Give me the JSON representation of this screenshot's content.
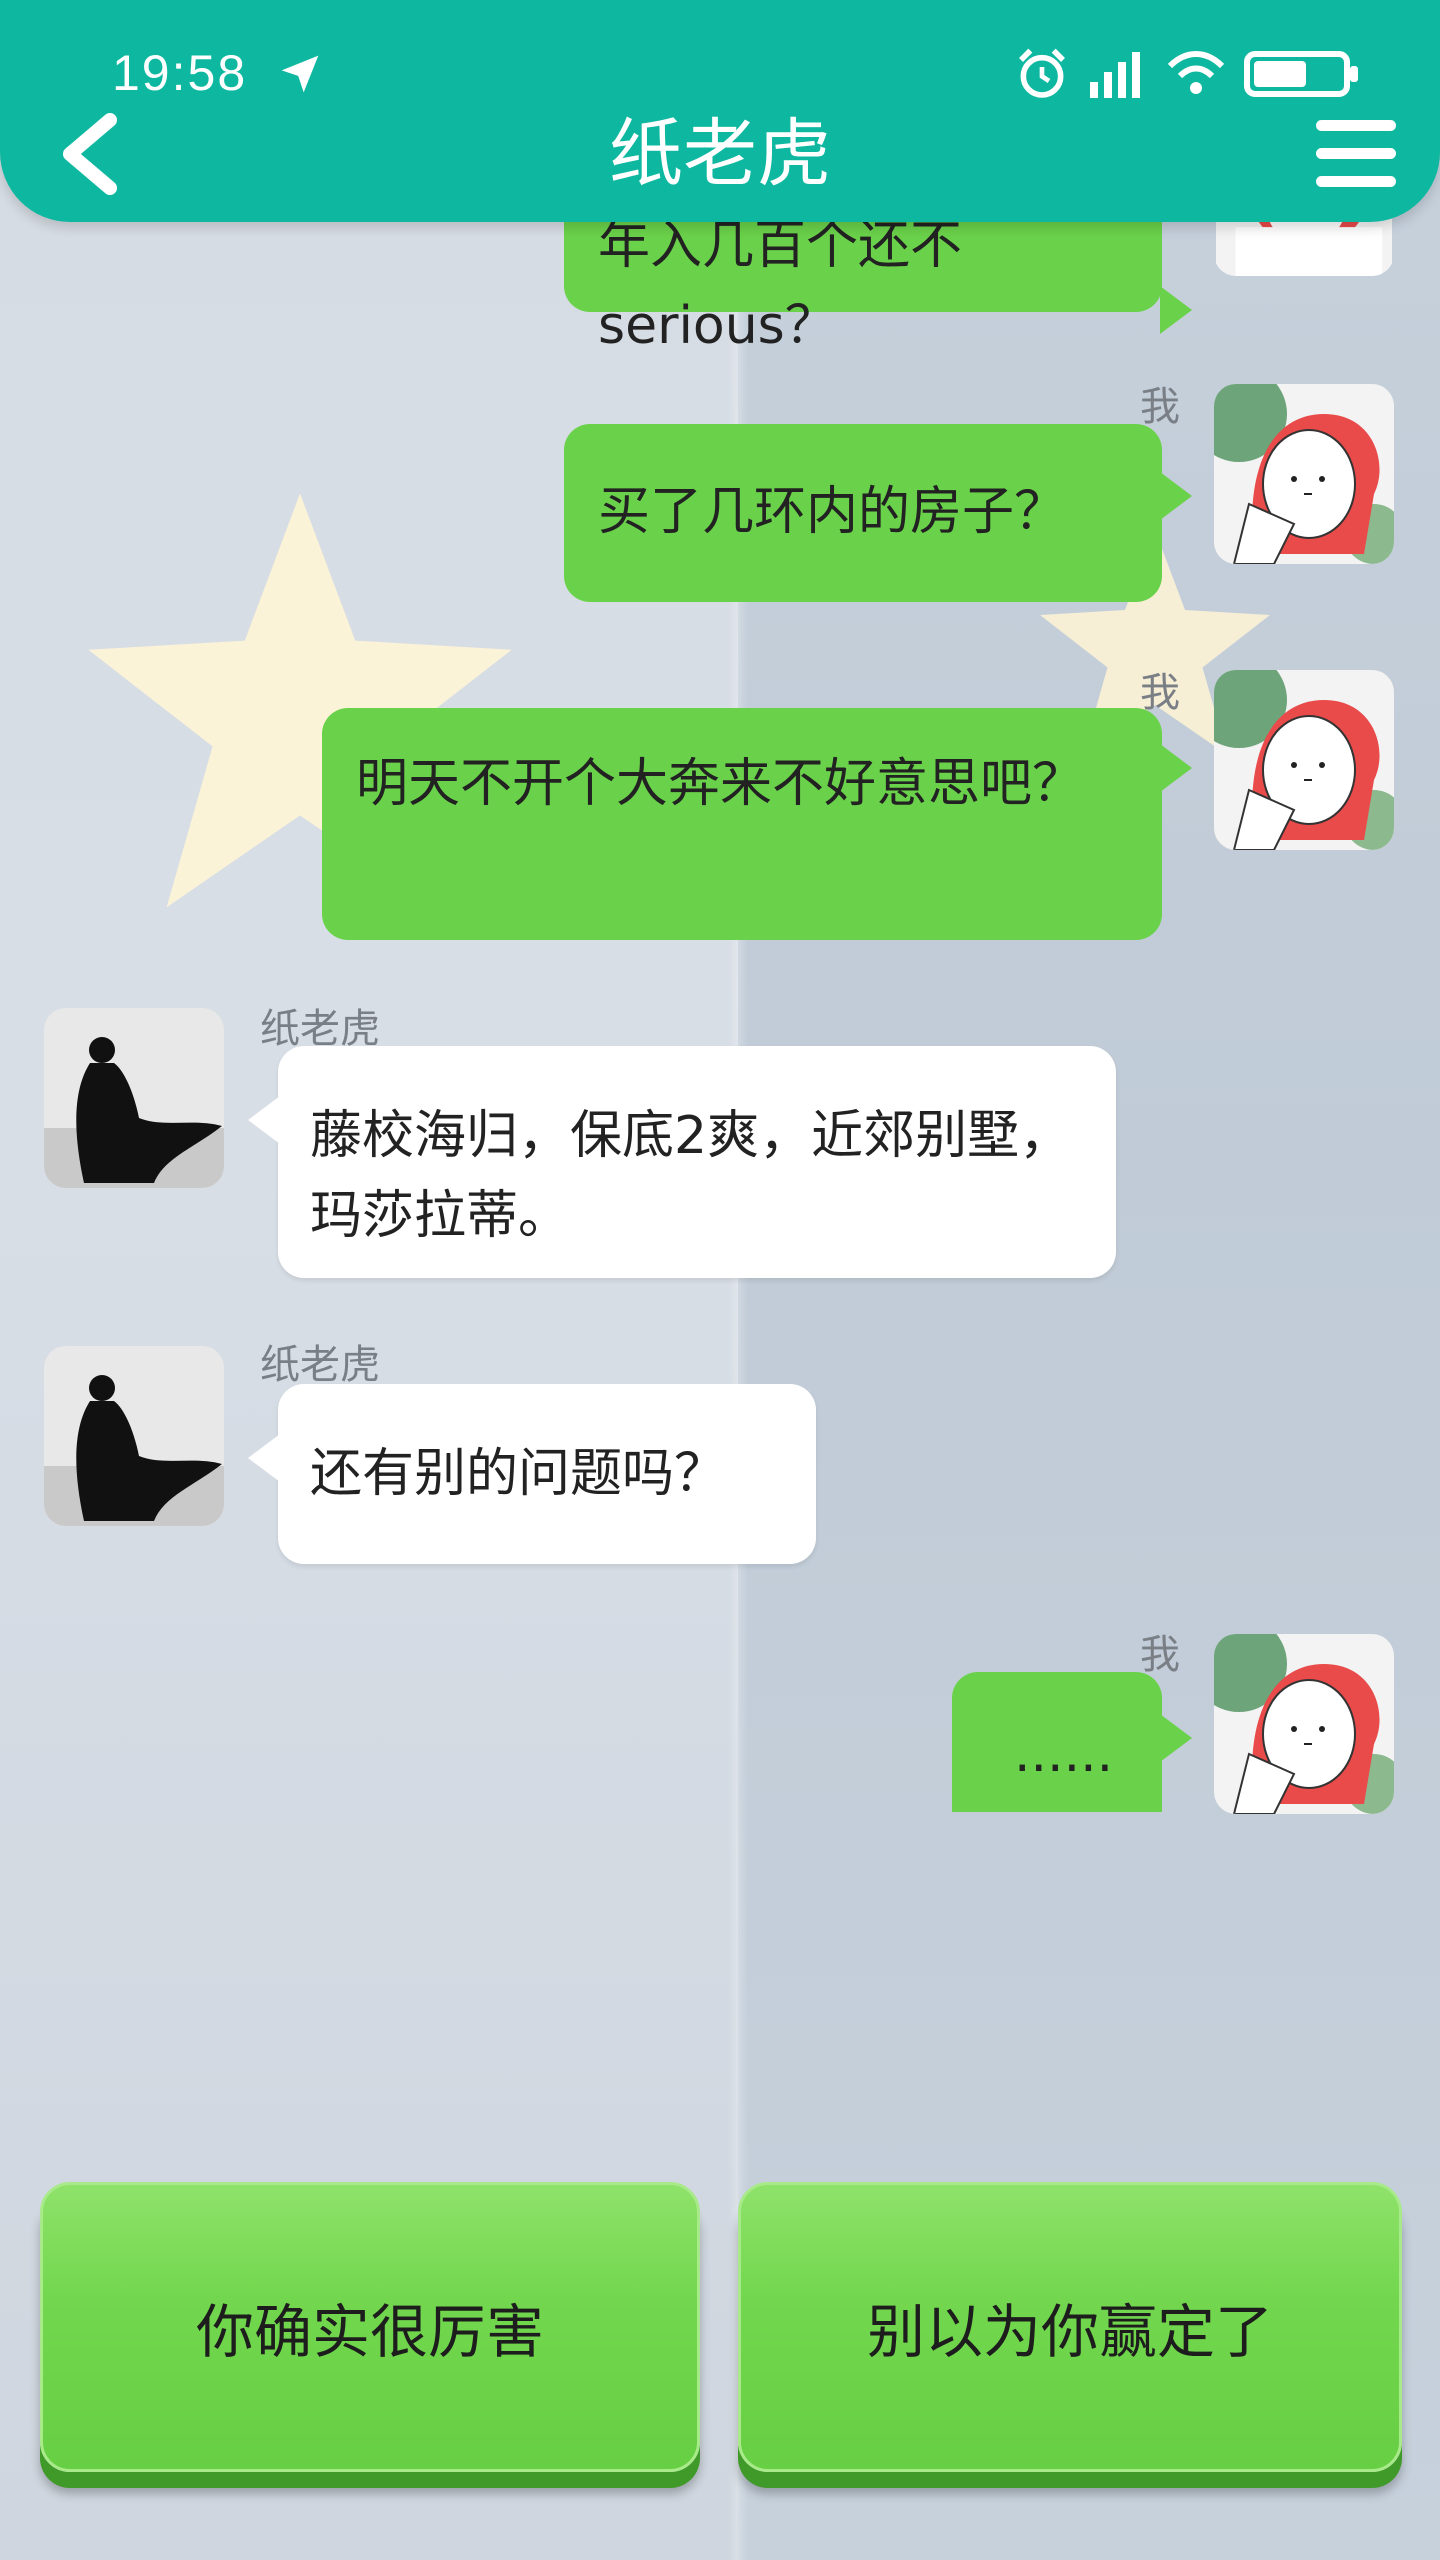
{
  "status_bar": {
    "time": "19:58",
    "icons": [
      "location-arrow-icon",
      "alarm-icon",
      "signal-icon",
      "wifi-icon",
      "battery-icon"
    ]
  },
  "header": {
    "title": "纸老虎",
    "back_icon": "chevron-left-icon",
    "menu_icon": "hamburger-menu-icon"
  },
  "messages": [
    {
      "sender": "me",
      "label": "",
      "text": "年入几百个还不serious？"
    },
    {
      "sender": "me",
      "label": "我",
      "text": "买了几环内的房子？"
    },
    {
      "sender": "me",
      "label": "我",
      "text": "明天不开个大奔来不好意思吧？"
    },
    {
      "sender": "them",
      "label": "纸老虎",
      "text": "藤校海归，保底2爽，近郊别墅，玛莎拉蒂。"
    },
    {
      "sender": "them",
      "label": "纸老虎",
      "text": "还有别的问题吗？"
    },
    {
      "sender": "me",
      "label": "我",
      "text": "......"
    }
  ],
  "choices": [
    {
      "label": "你确实很厉害"
    },
    {
      "label": "别以为你赢定了"
    }
  ],
  "colors": {
    "header": "#0eb8a0",
    "my_bubble": "#6ad24a",
    "their_bubble": "#ffffff",
    "choice_button": "#6fd449"
  }
}
